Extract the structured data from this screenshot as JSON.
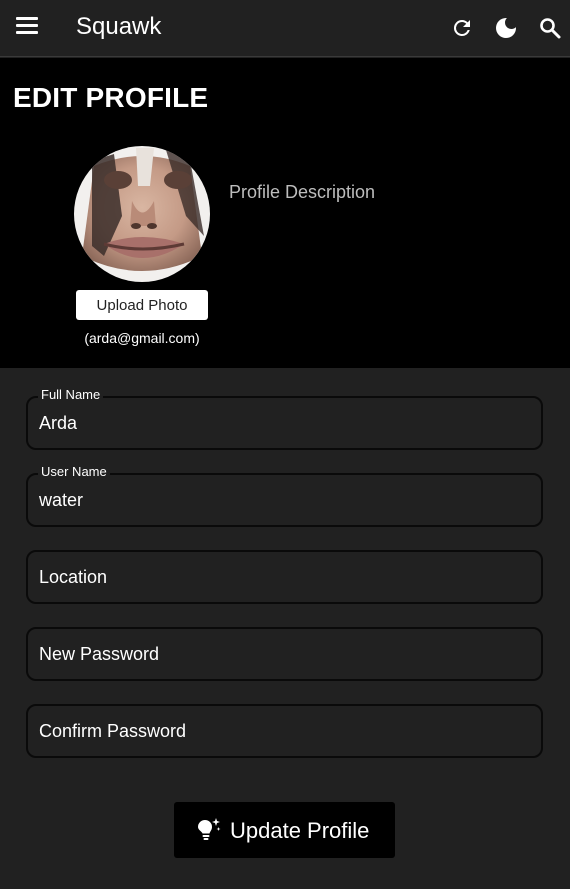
{
  "appbar": {
    "title": "Squawk",
    "icons": [
      "menu-icon",
      "refresh-icon",
      "moon-icon",
      "search-icon"
    ]
  },
  "profile": {
    "heading": "EDIT PROFILE",
    "upload_label": "Upload Photo",
    "email": "(arda@gmail.com)",
    "description_placeholder": "Profile Description"
  },
  "form": {
    "full_name": {
      "label": "Full Name",
      "value": "Arda"
    },
    "user_name": {
      "label": "User Name",
      "value": "water"
    },
    "location": {
      "placeholder": "Location"
    },
    "new_password": {
      "placeholder": "New Password"
    },
    "confirm_password": {
      "placeholder": "Confirm Password"
    }
  },
  "actions": {
    "update_label": "Update Profile",
    "update_icon": "lightbulb-icon"
  },
  "colors": {
    "background": "#212121",
    "header_background": "#000000",
    "button_background": "#000000",
    "upload_button": "#ffffff"
  }
}
